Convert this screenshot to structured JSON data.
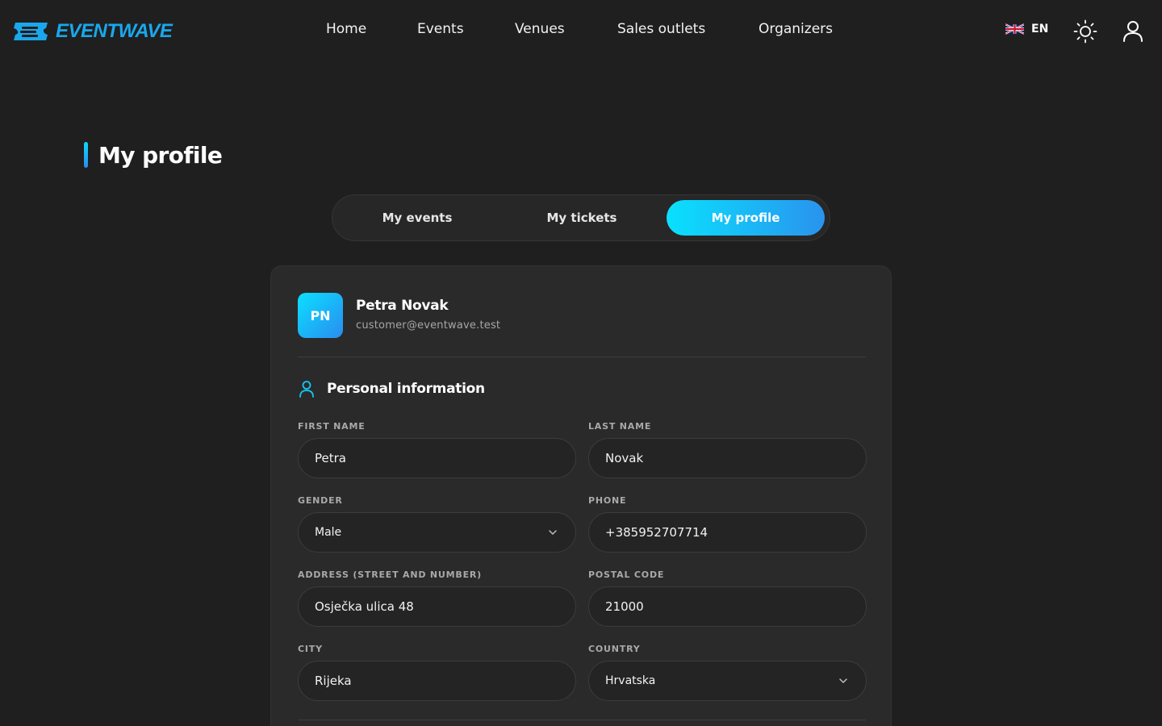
{
  "brand": {
    "name": "EVENTWAVE",
    "accent": "#1aa7ec",
    "gradient_start": "#09e1fe",
    "gradient_end": "#2a93ee"
  },
  "nav": [
    {
      "label": "Home"
    },
    {
      "label": "Events"
    },
    {
      "label": "Venues"
    },
    {
      "label": "Sales outlets"
    },
    {
      "label": "Organizers"
    }
  ],
  "header": {
    "language": {
      "code": "EN",
      "flag_icon": "uk-flag-icon"
    },
    "theme_icon": "sun-icon",
    "account_icon": "user-icon"
  },
  "page": {
    "title": "My profile"
  },
  "tabs": [
    {
      "label": "My events",
      "active": false
    },
    {
      "label": "My tickets",
      "active": false
    },
    {
      "label": "My profile",
      "active": true
    }
  ],
  "profile": {
    "initials": "PN",
    "name": "Petra Novak",
    "email": "customer@eventwave.test"
  },
  "personal_info": {
    "title": "Personal information",
    "icon": "person-icon",
    "first_name": {
      "label": "First name",
      "value": "Petra"
    },
    "last_name": {
      "label": "Last name",
      "value": "Novak"
    },
    "gender": {
      "label": "Gender",
      "value": "Male"
    },
    "phone": {
      "label": "Phone",
      "value": "+385952707714"
    },
    "address": {
      "label": "Address (street and number)",
      "value": "Osječka ulica 48"
    },
    "postal_code": {
      "label": "Postal code",
      "value": "21000"
    },
    "city": {
      "label": "City",
      "value": "Rijeka"
    },
    "country": {
      "label": "Country",
      "value": "Hrvatska"
    }
  }
}
